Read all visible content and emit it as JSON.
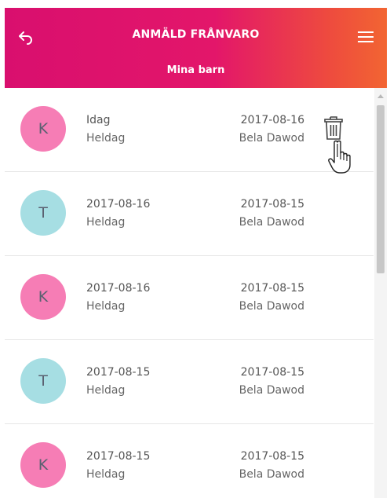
{
  "header": {
    "title": "ANMÄLD FRÅNVARO",
    "subtitle": "Mina barn",
    "back_icon": "back-arrow-icon",
    "menu_icon": "hamburger-menu-icon"
  },
  "colors": {
    "header_gradient_start": "#d90f6e",
    "header_gradient_end": "#f26532",
    "avatar_pink": "#f67db5",
    "avatar_cyan": "#a6dee3"
  },
  "absences": [
    {
      "initial": "K",
      "color": "#f67db5",
      "date": "Idag",
      "duration": "Heldag",
      "reported_date": "2017-08-16",
      "reported_by": "Bela Dawod",
      "show_delete": true
    },
    {
      "initial": "T",
      "color": "#a6dee3",
      "date": "2017-08-16",
      "duration": "Heldag",
      "reported_date": "2017-08-15",
      "reported_by": "Bela Dawod",
      "show_delete": false
    },
    {
      "initial": "K",
      "color": "#f67db5",
      "date": "2017-08-16",
      "duration": "Heldag",
      "reported_date": "2017-08-15",
      "reported_by": "Bela Dawod",
      "show_delete": false
    },
    {
      "initial": "T",
      "color": "#a6dee3",
      "date": "2017-08-15",
      "duration": "Heldag",
      "reported_date": "2017-08-15",
      "reported_by": "Bela Dawod",
      "show_delete": false
    },
    {
      "initial": "K",
      "color": "#f67db5",
      "date": "2017-08-15",
      "duration": "Heldag",
      "reported_date": "2017-08-15",
      "reported_by": "Bela Dawod",
      "show_delete": false
    }
  ]
}
